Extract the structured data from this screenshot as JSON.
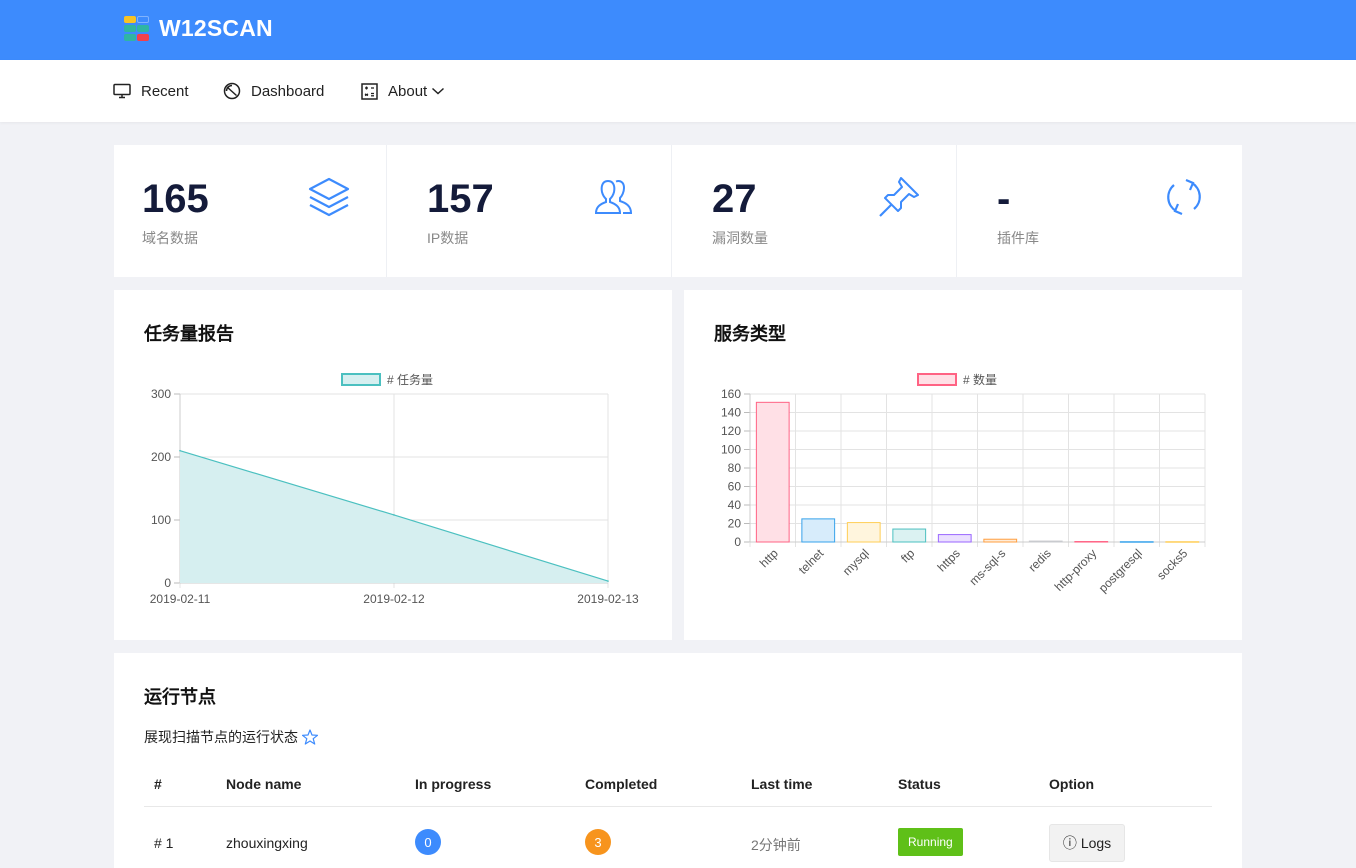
{
  "app": {
    "title": "W12SCAN"
  },
  "nav": [
    {
      "label": "Recent",
      "icon": "monitor-icon"
    },
    {
      "label": "Dashboard",
      "icon": "dashboard-icon"
    },
    {
      "label": "About",
      "icon": "calculator-icon"
    }
  ],
  "stats": [
    {
      "value": "165",
      "label": "域名数据",
      "icon": "layers-icon"
    },
    {
      "value": "157",
      "label": "IP数据",
      "icon": "users-icon"
    },
    {
      "value": "27",
      "label": "漏洞数量",
      "icon": "pin-icon"
    },
    {
      "value": "-",
      "label": "插件库",
      "icon": "refresh-icon"
    }
  ],
  "task_card": {
    "title": "任务量报告"
  },
  "service_card": {
    "title": "服务类型"
  },
  "chart_data": [
    {
      "type": "area",
      "title": "",
      "legend": [
        "# 任务量"
      ],
      "x": [
        "2019-02-11",
        "2019-02-12",
        "2019-02-13"
      ],
      "series": [
        {
          "name": "# 任务量",
          "values": [
            210,
            108,
            3
          ]
        }
      ],
      "ylim": [
        0,
        300
      ],
      "yticks": [
        0,
        100,
        200,
        300
      ],
      "grid": true,
      "legend_position": "top",
      "colors": {
        "fill": "#d6eff0",
        "line": "#4bc0c0"
      }
    },
    {
      "type": "bar",
      "title": "",
      "legend": [
        "# 数量"
      ],
      "categories": [
        "http",
        "telnet",
        "mysql",
        "ftp",
        "https",
        "ms-sql-s",
        "redis",
        "http-proxy",
        "postgresql",
        "socks5"
      ],
      "series": [
        {
          "name": "# 数量",
          "values": [
            151,
            25,
            21,
            14,
            8,
            3,
            1,
            0.5,
            0.3,
            0.3
          ]
        }
      ],
      "ylim": [
        0,
        160
      ],
      "yticks": [
        0,
        20,
        40,
        60,
        80,
        100,
        120,
        140,
        160
      ],
      "grid": true,
      "legend_position": "top",
      "colors": {
        "fills": [
          "#ffe0e6",
          "#d7ecfb",
          "#fff5dd",
          "#dbf2f2",
          "#ebe0ff",
          "#ffecd9",
          "#f4f5f5",
          "#ffe0e6",
          "#d7ecfb",
          "#fff5dd"
        ],
        "borders": [
          "#ff6384",
          "#36a2eb",
          "#ffce56",
          "#4bc0c0",
          "#9966ff",
          "#ff9f40",
          "#c9cbcf",
          "#ff6384",
          "#36a2eb",
          "#ffce56"
        ]
      }
    }
  ],
  "nodes": {
    "title": "运行节点",
    "subtitle": "展现扫描节点的运行状态",
    "columns": [
      "#",
      "Node name",
      "In progress",
      "Completed",
      "Last time",
      "Status",
      "Option"
    ],
    "rows": [
      {
        "id": "# 1",
        "name": "zhouxingxing",
        "in_progress": "0",
        "completed": "3",
        "last_time": "2分钟前",
        "status": "Running",
        "option": "Logs"
      }
    ]
  },
  "colors": {
    "brand": "#3d8bfd",
    "accent": "#3d8bfd",
    "running": "#5fc018",
    "completed_badge": "#f7941d"
  }
}
